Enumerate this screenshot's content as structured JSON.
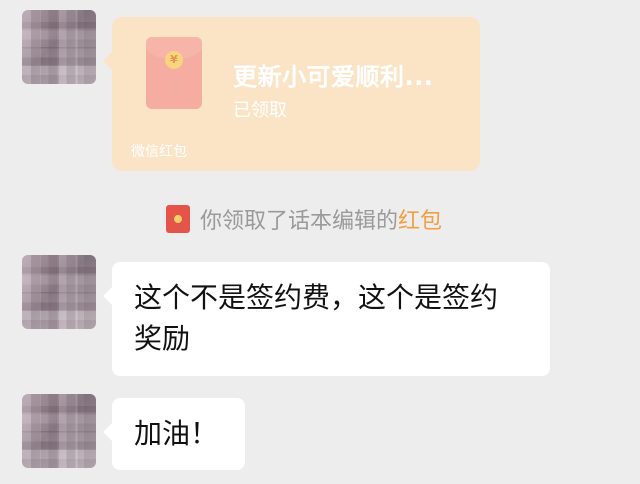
{
  "red_packet": {
    "title": "更新小可爱顺利...",
    "status": "已领取",
    "source": "微信红包",
    "coin_symbol": "¥"
  },
  "system_note": {
    "prefix": "你领取了话本编辑的",
    "link": "红包"
  },
  "messages": [
    {
      "text": "这个不是签约费，这个是签约\n奖励"
    },
    {
      "text": "加油！"
    }
  ]
}
